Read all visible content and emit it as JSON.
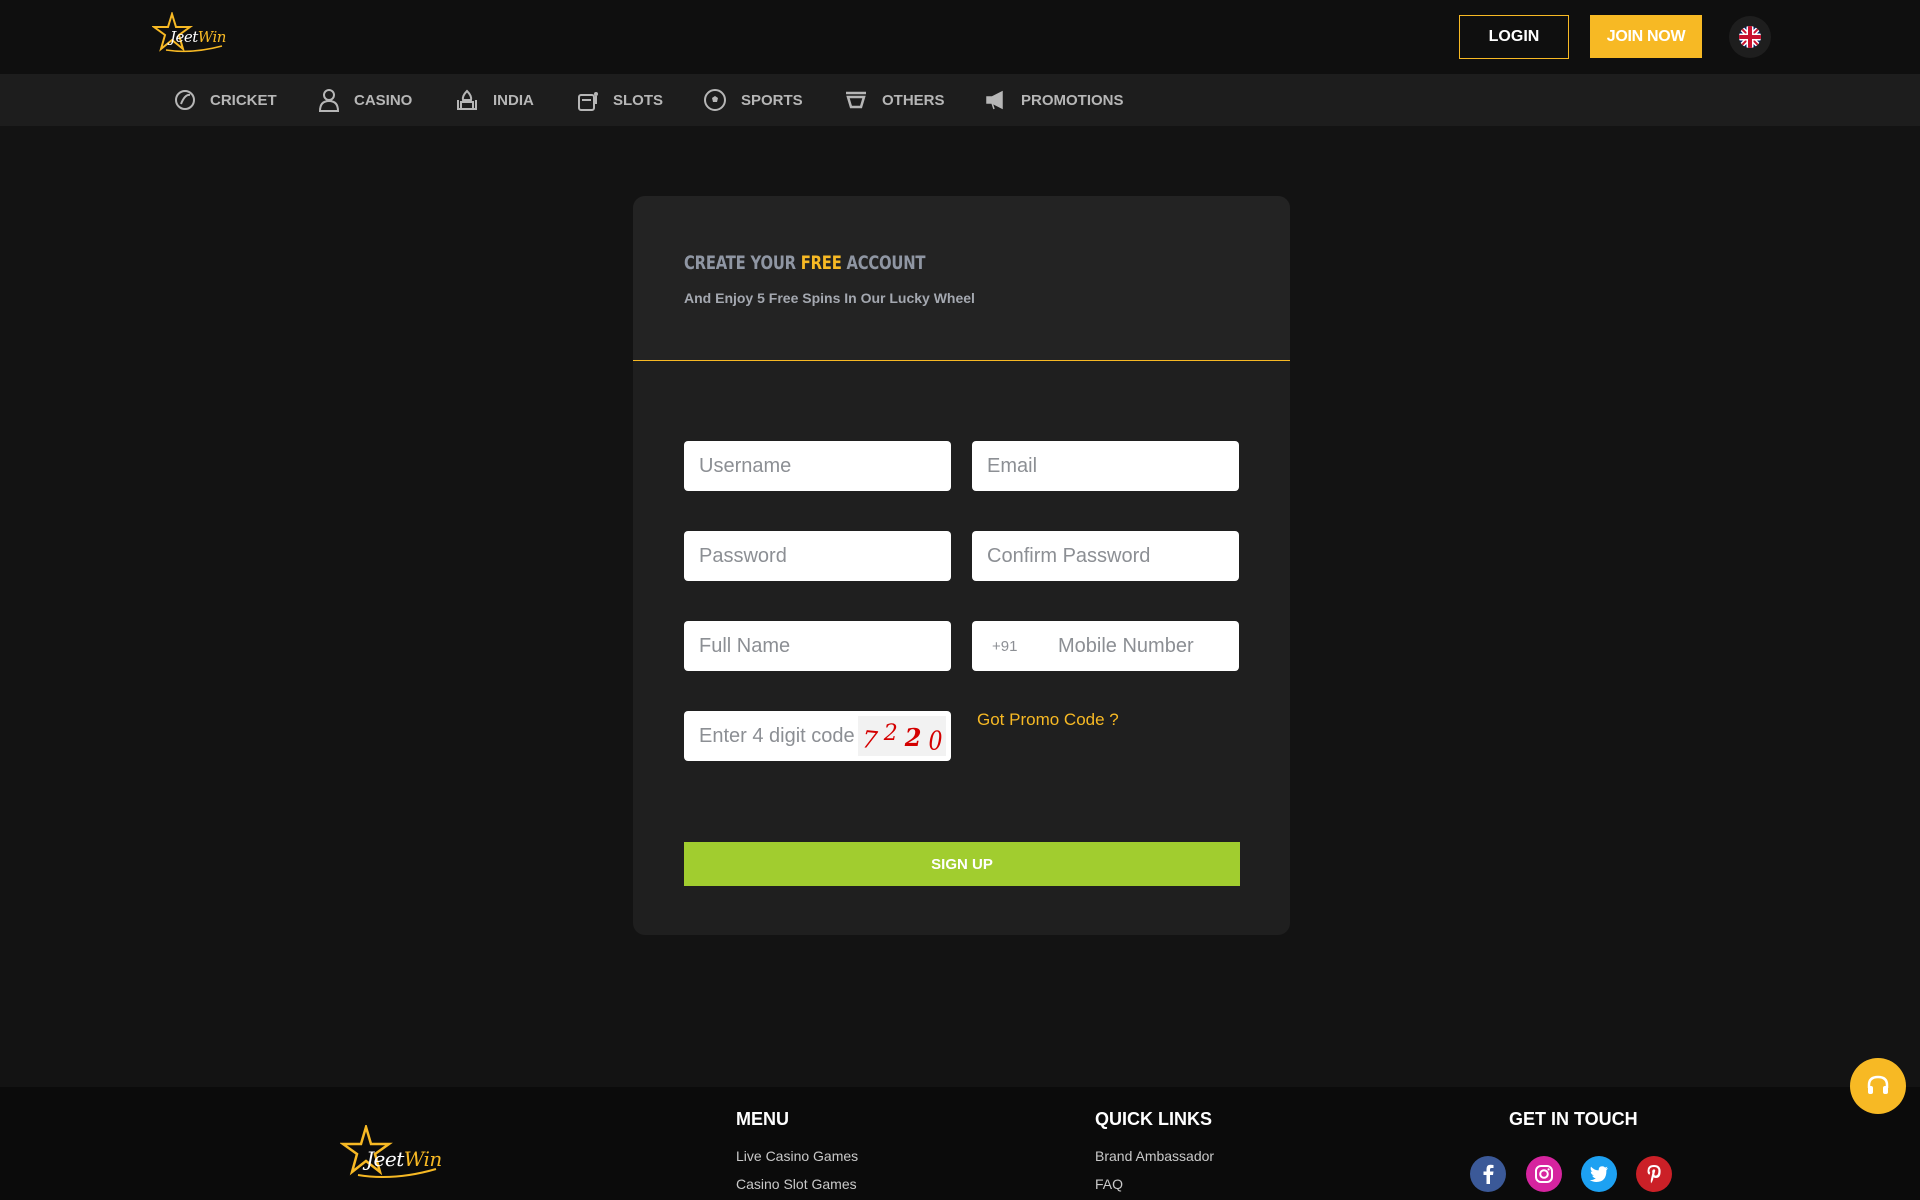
{
  "header": {
    "logo": {
      "jeet": "Jeet",
      "win": "Win"
    },
    "login_label": "LOGIN",
    "join_label": "JOIN NOW",
    "language_icon": "uk-flag-icon"
  },
  "nav": {
    "items": [
      {
        "label": "CRICKET",
        "icon": "cricket-ball-icon"
      },
      {
        "label": "CASINO",
        "icon": "dealer-icon"
      },
      {
        "label": "INDIA",
        "icon": "taj-mahal-icon"
      },
      {
        "label": "SLOTS",
        "icon": "slot-machine-icon"
      },
      {
        "label": "SPORTS",
        "icon": "soccer-ball-icon"
      },
      {
        "label": "OTHERS",
        "icon": "cup-icon"
      },
      {
        "label": "PROMOTIONS",
        "icon": "megaphone-icon"
      }
    ]
  },
  "form": {
    "title_pre": "CREATE YOUR",
    "title_highlight": "FREE",
    "title_post": "ACCOUNT",
    "subtitle": "And Enjoy 5 Free Spins In Our Lucky Wheel",
    "username_placeholder": "Username",
    "email_placeholder": "Email",
    "password_placeholder": "Password",
    "confirm_password_placeholder": "Confirm Password",
    "fullname_placeholder": "Full Name",
    "phone_prefix": "+91",
    "mobile_placeholder": "Mobile Number",
    "captcha_placeholder": "Enter 4 digit code",
    "captcha_digits": [
      "7",
      "2",
      "2",
      "0"
    ],
    "promo_label": "Got Promo Code ?",
    "signup_label": "SIGN UP"
  },
  "footer": {
    "logo": {
      "jeet": "Jeet",
      "win": "Win"
    },
    "menu_heading": "MENU",
    "menu_links": [
      "Live Casino Games",
      "Casino Slot Games"
    ],
    "quick_heading": "QUICK LINKS",
    "quick_links": [
      "Brand Ambassador",
      "FAQ"
    ],
    "contact_heading": "GET IN TOUCH",
    "social": [
      {
        "icon": "facebook-icon",
        "color": "#3b5998"
      },
      {
        "icon": "instagram-icon",
        "color": "#d6249f"
      },
      {
        "icon": "twitter-icon",
        "color": "#1da1f2"
      },
      {
        "icon": "pinterest-icon",
        "color": "#cb2027"
      }
    ]
  },
  "colors": {
    "accent": "#f7b924",
    "signup": "#a1cd2f",
    "background": "#131313"
  }
}
